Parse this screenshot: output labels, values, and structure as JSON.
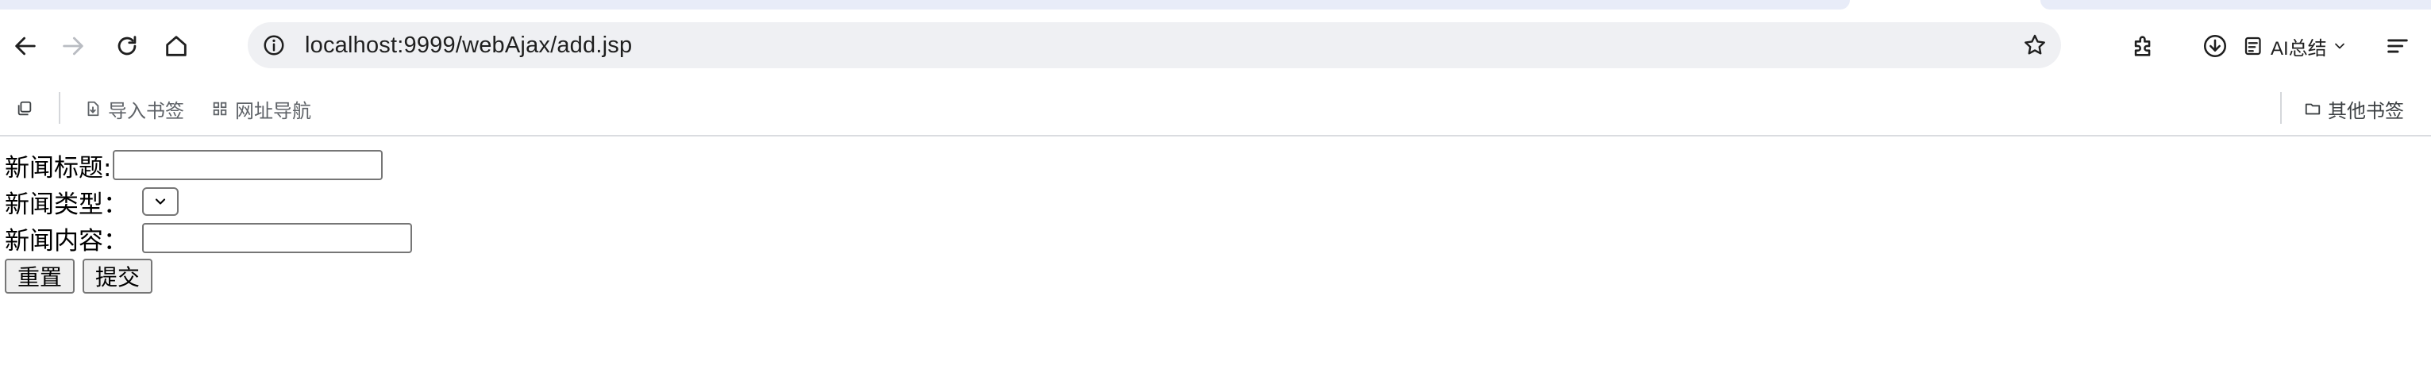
{
  "browser": {
    "url": "localhost:9999/webAjax/add.jsp",
    "ai_button_label": "AI总结"
  },
  "bookmarks": {
    "items": [
      {
        "label": "导入书签"
      },
      {
        "label": "网址导航"
      }
    ],
    "other_label": "其他书签"
  },
  "form": {
    "title_label": "新闻标题:",
    "title_value": "",
    "type_label": "新闻类型：",
    "type_selected": "",
    "content_label": "新闻内容：",
    "content_value": "",
    "reset_label": "重置",
    "submit_label": "提交"
  },
  "icons": {
    "back": "arrow-left-icon",
    "forward": "arrow-right-icon",
    "reload": "reload-icon",
    "home": "home-icon",
    "info": "info-icon",
    "star": "star-icon",
    "extensions": "puzzle-icon",
    "download": "download-icon",
    "ai": "ai-list-icon",
    "menu": "menu-icon",
    "tab_search": "tab-copy-icon",
    "import": "import-icon",
    "nav": "grid-icon",
    "folder": "folder-icon"
  },
  "colors": {
    "omnibox_bg": "#eff0f3",
    "tabstrip": "#e8ecf8",
    "icon": "#1f1f1f",
    "disabled_icon": "#b9bcc2",
    "bookmark_text": "#5f6368"
  }
}
